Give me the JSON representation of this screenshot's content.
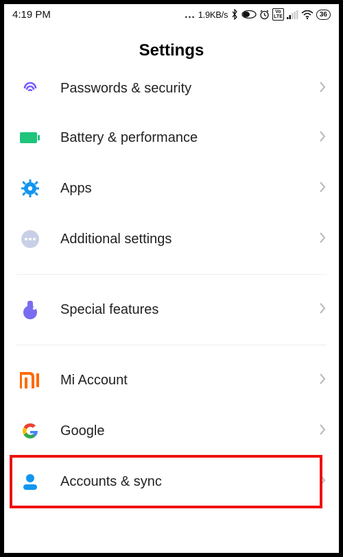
{
  "status": {
    "time": "4:19 PM",
    "net_speed": "1.9KB/s",
    "battery_text": "36",
    "volte_label": "Vo LTE"
  },
  "header": {
    "title": "Settings"
  },
  "rows": {
    "passwords": {
      "label": "Passwords & security"
    },
    "battery": {
      "label": "Battery & performance"
    },
    "apps": {
      "label": "Apps"
    },
    "additional": {
      "label": "Additional settings"
    },
    "special": {
      "label": "Special features"
    },
    "miaccount": {
      "label": "Mi Account"
    },
    "google": {
      "label": "Google"
    },
    "accounts": {
      "label": "Accounts & sync"
    }
  }
}
